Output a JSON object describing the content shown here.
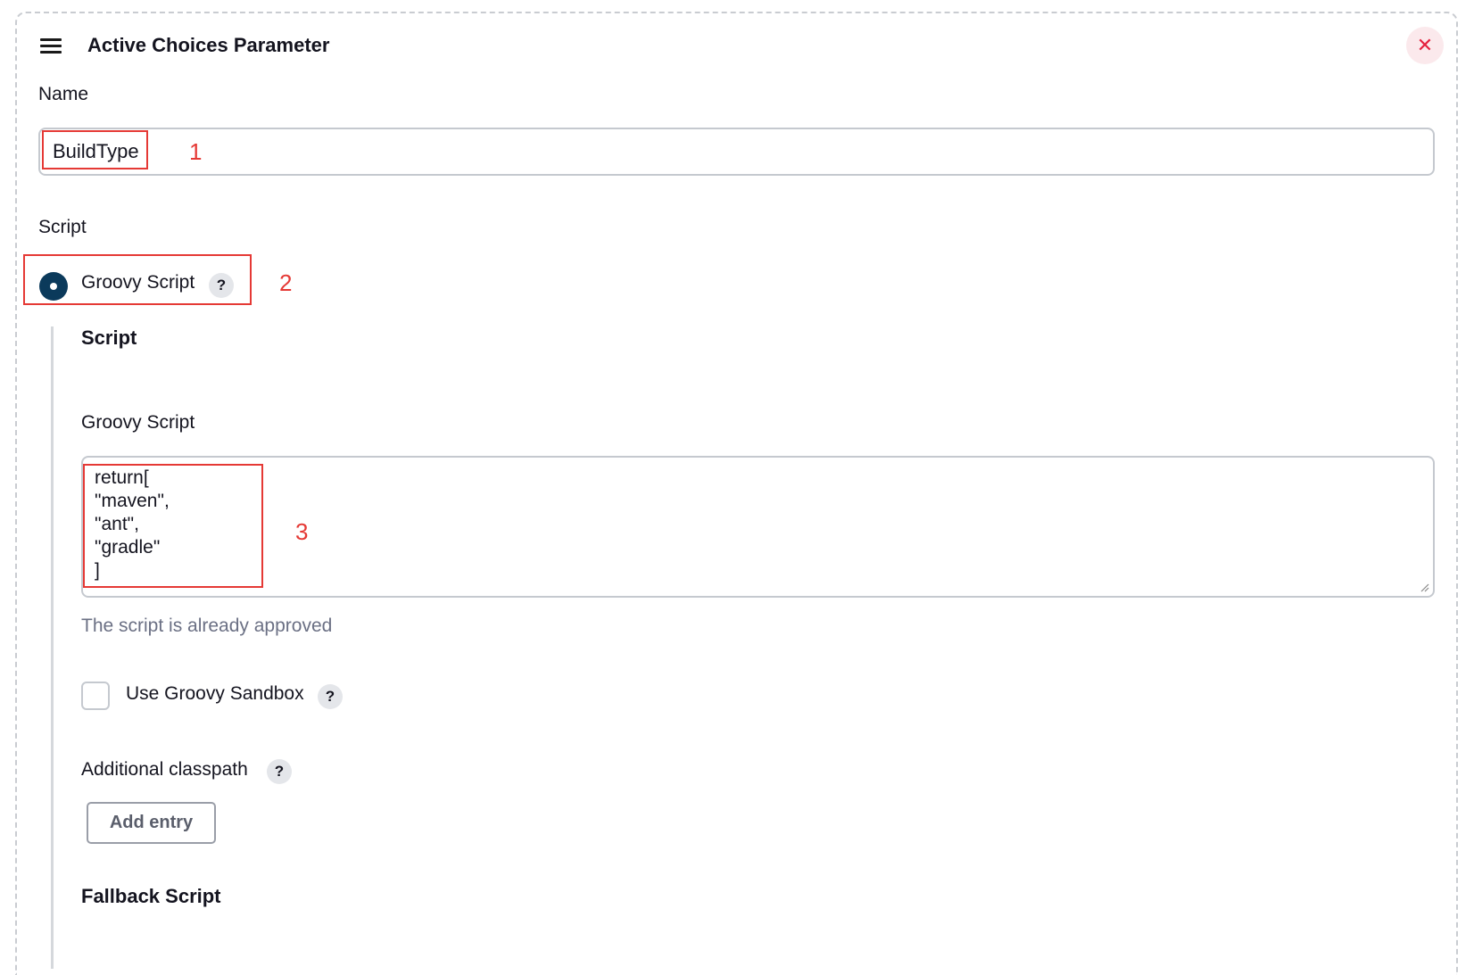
{
  "header": {
    "title": "Active Choices Parameter",
    "menu_icon": "hamburger-menu-icon",
    "close_icon": "close-icon",
    "close_glyph": "✕"
  },
  "name_field": {
    "label": "Name",
    "value": "BuildType"
  },
  "script_section": {
    "label": "Script",
    "option_label": "Groovy Script",
    "option_selected": true,
    "help_glyph": "?"
  },
  "groovy_script": {
    "heading": "Script",
    "field_label": "Groovy Script",
    "code_lines": [
      "return[",
      "\"maven\",",
      "\"ant\",",
      "\"gradle\"",
      "]"
    ],
    "approval_status": "The script is already approved"
  },
  "sandbox": {
    "label": "Use Groovy Sandbox",
    "checked": false,
    "help_glyph": "?"
  },
  "classpath": {
    "label": "Additional classpath",
    "help_glyph": "?",
    "add_button_label": "Add entry"
  },
  "fallback": {
    "heading": "Fallback Script"
  },
  "annotations": {
    "marker_1": "1",
    "marker_2": "2",
    "marker_3": "3",
    "color": "#e53935"
  },
  "colors": {
    "radio_selected": "#0b3a5b",
    "close_bg": "#fbe9ec",
    "close_fg": "#e5213d"
  }
}
